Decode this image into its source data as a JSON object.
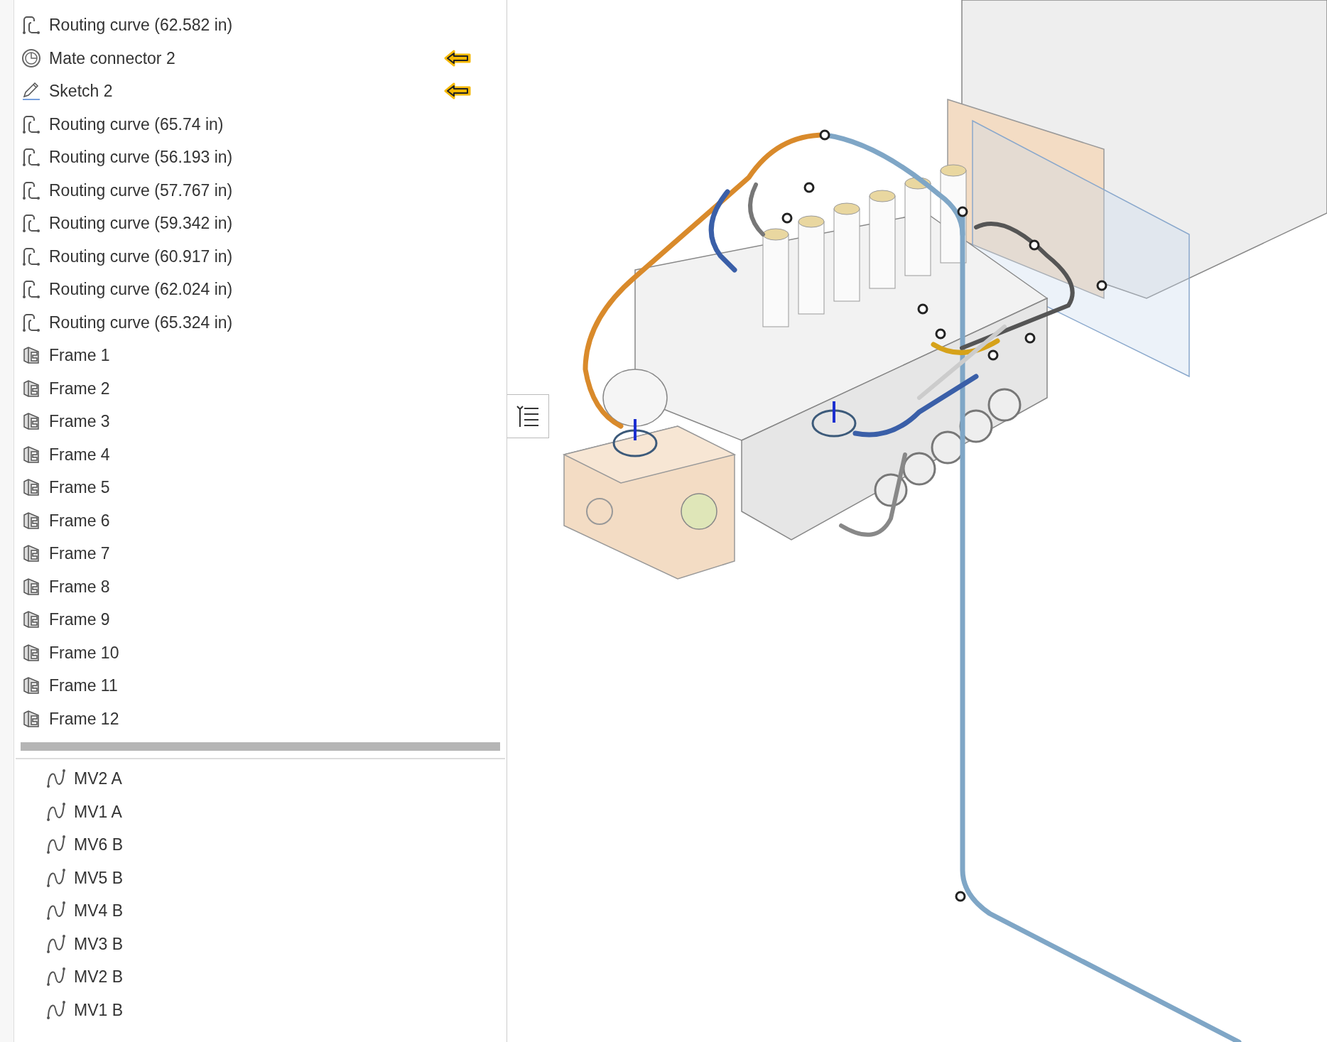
{
  "feature_tree": {
    "items": [
      {
        "kind": "routing",
        "label": "Routing curve (62.582 in)",
        "arrow": false
      },
      {
        "kind": "mate",
        "label": "Mate connector 2",
        "arrow": true
      },
      {
        "kind": "sketch",
        "label": "Sketch 2",
        "arrow": true
      },
      {
        "kind": "routing",
        "label": "Routing curve (65.74 in)",
        "arrow": false
      },
      {
        "kind": "routing",
        "label": "Routing curve (56.193 in)",
        "arrow": false
      },
      {
        "kind": "routing",
        "label": "Routing curve (57.767 in)",
        "arrow": false
      },
      {
        "kind": "routing",
        "label": "Routing curve (59.342 in)",
        "arrow": false
      },
      {
        "kind": "routing",
        "label": "Routing curve (60.917 in)",
        "arrow": false
      },
      {
        "kind": "routing",
        "label": "Routing curve (62.024 in)",
        "arrow": false
      },
      {
        "kind": "routing",
        "label": "Routing curve (65.324 in)",
        "arrow": false
      },
      {
        "kind": "frame",
        "label": "Frame 1",
        "arrow": false
      },
      {
        "kind": "frame",
        "label": "Frame 2",
        "arrow": false
      },
      {
        "kind": "frame",
        "label": "Frame 3",
        "arrow": false
      },
      {
        "kind": "frame",
        "label": "Frame 4",
        "arrow": false
      },
      {
        "kind": "frame",
        "label": "Frame 5",
        "arrow": false
      },
      {
        "kind": "frame",
        "label": "Frame 6",
        "arrow": false
      },
      {
        "kind": "frame",
        "label": "Frame 7",
        "arrow": false
      },
      {
        "kind": "frame",
        "label": "Frame 8",
        "arrow": false
      },
      {
        "kind": "frame",
        "label": "Frame 9",
        "arrow": false
      },
      {
        "kind": "frame",
        "label": "Frame 10",
        "arrow": false
      },
      {
        "kind": "frame",
        "label": "Frame 11",
        "arrow": false
      },
      {
        "kind": "frame",
        "label": "Frame 12",
        "arrow": false
      }
    ]
  },
  "curves_list": {
    "items": [
      {
        "label": "MV2 A"
      },
      {
        "label": "MV1 A"
      },
      {
        "label": "MV6 B"
      },
      {
        "label": "MV5 B"
      },
      {
        "label": "MV4 B"
      },
      {
        "label": "MV3 B"
      },
      {
        "label": "MV2 B"
      },
      {
        "label": "MV1 B"
      }
    ]
  }
}
